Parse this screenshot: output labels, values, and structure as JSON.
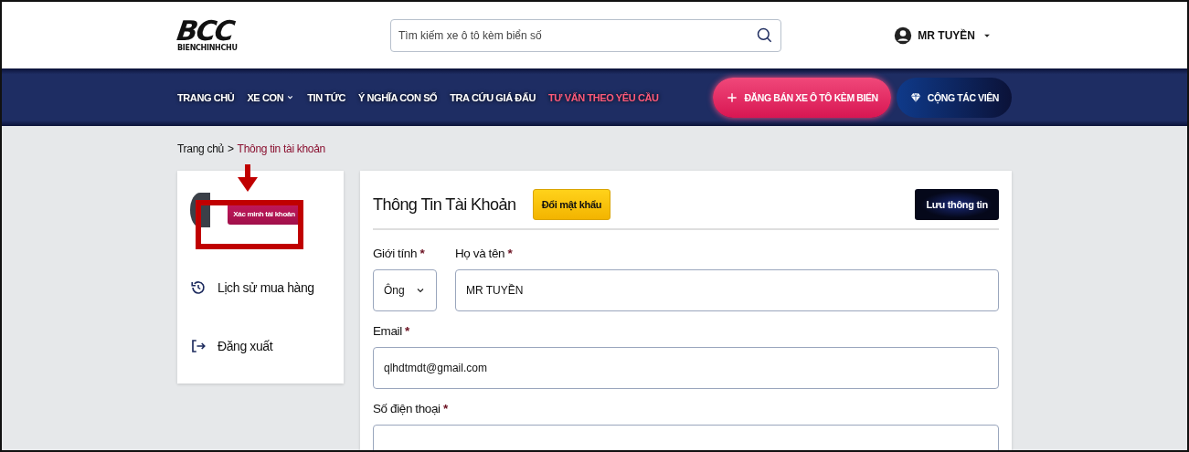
{
  "header": {
    "logo": {
      "mark": "BCC",
      "tagline": "BIENCHINHCHU"
    },
    "search": {
      "placeholder": "Tìm kiếm xe ô tô kèm biển số"
    },
    "user": {
      "name": "MR TUYỀN"
    }
  },
  "nav": {
    "items": [
      {
        "label": "TRANG CHỦ",
        "highlighted": false,
        "has_dropdown": false
      },
      {
        "label": "XE CON",
        "highlighted": false,
        "has_dropdown": true
      },
      {
        "label": "TIN TỨC",
        "highlighted": false,
        "has_dropdown": false
      },
      {
        "label": "Ý NGHĨA CON SỐ",
        "highlighted": false,
        "has_dropdown": false
      },
      {
        "label": "TRA CỨU GIÁ ĐẤU",
        "highlighted": false,
        "has_dropdown": false
      },
      {
        "label": "TƯ VẤN THEO YÊU CẦU",
        "highlighted": true,
        "has_dropdown": false
      }
    ],
    "actions": [
      {
        "kind": "post",
        "label": "ĐĂNG BÁN XE Ô TÔ KÈM BIỂN"
      },
      {
        "kind": "partner",
        "label": "CỘNG TÁC VIÊN"
      }
    ]
  },
  "breadcrumb": {
    "separator": ">",
    "items": [
      {
        "label": "Trang chủ",
        "current": false
      },
      {
        "label": "Thông tin tài khoản",
        "current": true
      }
    ]
  },
  "sidebar": {
    "verify_button": "Xác minh tài khoản",
    "items": [
      {
        "kind": "history",
        "label": "Lịch sử mua hàng"
      },
      {
        "kind": "logout",
        "label": "Đăng xuất"
      }
    ]
  },
  "form": {
    "title": "Thông Tin Tài Khoản",
    "change_password": "Đổi mật khẩu",
    "save": "Lưu thông tin",
    "rows": [
      [
        {
          "kind": "select",
          "label": "Giới tính",
          "mark": "*",
          "value": "Ông"
        },
        {
          "kind": "text",
          "label": "Họ và tên",
          "mark": "*",
          "value": "MR TUYỀN"
        }
      ],
      [
        {
          "kind": "text",
          "label": "Email",
          "mark": "*",
          "value": "qlhdtmdt@gmail.com"
        }
      ],
      [
        {
          "kind": "text",
          "label": "Số điện thoại",
          "mark": "*"
        }
      ]
    ]
  }
}
